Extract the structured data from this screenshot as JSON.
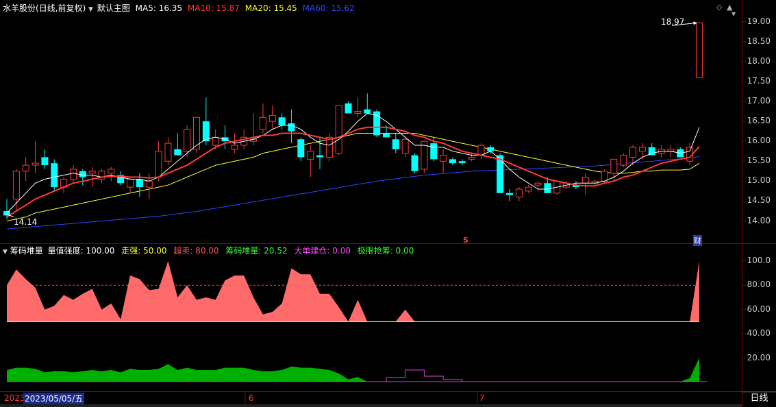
{
  "main_header": {
    "stock": "水羊股份",
    "period": "(日线,前复权)",
    "indicator_name": "默认主图",
    "ma": [
      {
        "label": "MA5: 16.35",
        "color": "#ffffff"
      },
      {
        "label": "MA10: 15.87",
        "color": "#ff3b3b"
      },
      {
        "label": "MA20: 15.45",
        "color": "#ffff33"
      },
      {
        "label": "MA60: 15.62",
        "color": "#3344ff"
      }
    ],
    "icons": [
      "diamond-icon",
      "up-arrow-icon",
      "down-arrow-icon"
    ]
  },
  "sub_header": {
    "name": "筹码堆量",
    "strength": "量值强度: 100.00",
    "items": [
      {
        "label": "走强: 50.00",
        "color": "#ffff33"
      },
      {
        "label": "超卖: 80.00",
        "color": "#ff5555"
      },
      {
        "label": "筹码堆量: 20.52",
        "color": "#33ff33"
      },
      {
        "label": "大单建仓: 0.00",
        "color": "#ff44ff"
      },
      {
        "label": "极限抢筹: 0.00",
        "color": "#33ff33"
      }
    ]
  },
  "main_axis_labels": [
    "19.00",
    "18.50",
    "18.00",
    "17.50",
    "17.00",
    "16.50",
    "16.00",
    "15.50",
    "15.00",
    "14.50",
    "14.00"
  ],
  "sub_axis_labels": [
    "100.0",
    "80.00",
    "60.00",
    "40.00",
    "20.00"
  ],
  "annotations": {
    "high_price": "18.97",
    "low_price": "14.14",
    "event_s": "S",
    "event_cai": "财"
  },
  "bottom_bar": {
    "year_prefix": "2023",
    "cursor_date": "2023/05/05/五",
    "month_6": "6",
    "month_7": "7",
    "period_button": "日线"
  },
  "colors": {
    "up": "#ff3b3b",
    "down": "#00ffff",
    "ma5": "#ffffff",
    "ma10": "#ff3b3b",
    "ma20": "#ffff33",
    "ma60": "#3344ff",
    "grid": "#8b0000",
    "area": "#ff6b6b",
    "volume": "#00b000"
  },
  "chart_data": {
    "type": "candlestick",
    "ylim": [
      13.7,
      19.2
    ],
    "candles": [
      [
        14.25,
        14.55,
        14.05,
        14.14
      ],
      [
        14.55,
        15.3,
        14.25,
        15.25
      ],
      [
        15.25,
        15.6,
        15.0,
        15.4
      ],
      [
        15.4,
        16.0,
        15.2,
        15.45
      ],
      [
        15.6,
        15.8,
        15.3,
        15.4
      ],
      [
        15.45,
        15.55,
        14.75,
        14.85
      ],
      [
        14.85,
        15.1,
        14.7,
        15.05
      ],
      [
        15.05,
        15.4,
        14.95,
        15.3
      ],
      [
        15.25,
        15.3,
        14.9,
        15.1
      ],
      [
        15.2,
        15.35,
        14.85,
        15.25
      ],
      [
        15.05,
        15.3,
        14.95,
        15.25
      ],
      [
        15.2,
        15.35,
        15.0,
        15.3
      ],
      [
        15.15,
        15.25,
        14.9,
        14.95
      ],
      [
        14.85,
        15.1,
        14.7,
        15.05
      ],
      [
        15.05,
        15.2,
        14.6,
        14.85
      ],
      [
        14.85,
        15.2,
        14.55,
        15.0
      ],
      [
        15.1,
        16.0,
        15.0,
        15.75
      ],
      [
        15.5,
        16.1,
        15.4,
        15.95
      ],
      [
        15.8,
        16.2,
        15.7,
        15.65
      ],
      [
        15.75,
        16.4,
        15.6,
        16.3
      ],
      [
        15.8,
        16.6,
        15.7,
        16.6
      ],
      [
        16.5,
        17.1,
        15.9,
        16.0
      ],
      [
        15.9,
        16.3,
        15.8,
        16.1
      ],
      [
        16.1,
        16.4,
        15.8,
        16.0
      ],
      [
        15.8,
        16.2,
        15.7,
        15.9
      ],
      [
        15.9,
        16.3,
        15.8,
        16.1
      ],
      [
        16.0,
        16.7,
        15.9,
        16.05
      ],
      [
        16.3,
        16.95,
        16.2,
        16.6
      ],
      [
        16.5,
        16.9,
        16.3,
        16.65
      ],
      [
        16.6,
        16.7,
        16.3,
        16.4
      ],
      [
        16.45,
        16.8,
        15.95,
        16.25
      ],
      [
        16.05,
        16.1,
        15.5,
        15.6
      ],
      [
        15.55,
        15.9,
        15.1,
        15.75
      ],
      [
        15.65,
        16.1,
        15.3,
        15.6
      ],
      [
        15.6,
        16.2,
        15.5,
        16.1
      ],
      [
        15.7,
        16.75,
        15.65,
        16.9
      ],
      [
        16.95,
        17.0,
        16.8,
        16.7
      ],
      [
        16.7,
        17.1,
        16.6,
        16.75
      ],
      [
        16.8,
        17.2,
        16.7,
        16.7
      ],
      [
        16.75,
        16.8,
        16.1,
        16.15
      ],
      [
        16.2,
        16.4,
        16.1,
        16.1
      ],
      [
        16.05,
        16.2,
        15.7,
        15.8
      ],
      [
        15.7,
        16.1,
        15.6,
        16.05
      ],
      [
        15.65,
        15.7,
        15.2,
        15.25
      ],
      [
        15.3,
        16.0,
        15.2,
        16.0
      ],
      [
        15.95,
        16.1,
        15.5,
        15.55
      ],
      [
        15.5,
        15.8,
        15.2,
        15.65
      ],
      [
        15.55,
        15.6,
        15.4,
        15.45
      ],
      [
        15.5,
        15.55,
        15.4,
        15.45
      ],
      [
        15.55,
        15.7,
        15.5,
        15.6
      ],
      [
        15.65,
        15.95,
        15.55,
        15.9
      ],
      [
        15.85,
        15.9,
        15.7,
        15.75
      ],
      [
        15.65,
        15.7,
        14.7,
        14.7
      ],
      [
        14.7,
        14.8,
        14.5,
        14.65
      ],
      [
        14.6,
        14.85,
        14.5,
        14.8
      ],
      [
        14.75,
        14.9,
        14.7,
        14.85
      ],
      [
        14.9,
        15.0,
        14.75,
        14.95
      ],
      [
        14.95,
        15.1,
        14.7,
        14.7
      ],
      [
        14.7,
        15.0,
        14.65,
        15.0
      ],
      [
        14.85,
        15.0,
        14.8,
        14.95
      ],
      [
        14.9,
        15.0,
        14.8,
        14.85
      ],
      [
        14.95,
        15.2,
        14.65,
        15.1
      ],
      [
        14.95,
        15.05,
        14.9,
        15.0
      ],
      [
        15.0,
        15.3,
        14.95,
        15.25
      ],
      [
        15.2,
        15.55,
        15.0,
        15.55
      ],
      [
        15.4,
        15.7,
        15.35,
        15.65
      ],
      [
        15.6,
        15.9,
        15.4,
        15.85
      ],
      [
        15.75,
        15.95,
        15.55,
        15.85
      ],
      [
        15.85,
        15.95,
        15.75,
        15.65
      ],
      [
        15.7,
        15.9,
        15.6,
        15.8
      ],
      [
        15.75,
        15.9,
        15.6,
        15.8
      ],
      [
        15.8,
        15.85,
        15.6,
        15.6
      ],
      [
        15.5,
        15.95,
        15.4,
        15.85
      ],
      [
        17.6,
        18.97,
        17.6,
        18.97
      ]
    ],
    "ma_series": [
      {
        "name": "MA5",
        "color": "#ffffff",
        "values": [
          14.2,
          14.45,
          14.7,
          14.95,
          15.05,
          15.1,
          15.15,
          15.2,
          15.15,
          15.15,
          15.1,
          15.15,
          15.1,
          15.05,
          15.05,
          15.0,
          15.1,
          15.3,
          15.5,
          15.7,
          15.9,
          16.05,
          16.1,
          16.05,
          15.95,
          16.0,
          16.05,
          16.15,
          16.3,
          16.4,
          16.4,
          16.3,
          16.1,
          15.95,
          15.9,
          16.05,
          16.25,
          16.5,
          16.7,
          16.65,
          16.5,
          16.3,
          16.1,
          15.9,
          15.9,
          15.85,
          15.85,
          15.75,
          15.7,
          15.65,
          15.65,
          15.75,
          15.55,
          15.3,
          15.1,
          14.95,
          14.8,
          14.8,
          14.85,
          14.9,
          14.95,
          14.95,
          14.95,
          15.0,
          15.1,
          15.25,
          15.45,
          15.6,
          15.7,
          15.75,
          15.75,
          15.7,
          15.75,
          16.35
        ]
      },
      {
        "name": "MA10",
        "color": "#ff3b3b",
        "values": [
          14.1,
          14.25,
          14.4,
          14.55,
          14.65,
          14.75,
          14.85,
          14.95,
          15.0,
          15.05,
          15.1,
          15.12,
          15.12,
          15.1,
          15.1,
          15.08,
          15.1,
          15.2,
          15.3,
          15.4,
          15.55,
          15.7,
          15.85,
          15.95,
          16.0,
          16.05,
          16.1,
          16.15,
          16.15,
          16.2,
          16.2,
          16.2,
          16.15,
          16.1,
          16.05,
          16.1,
          16.2,
          16.3,
          16.35,
          16.35,
          16.35,
          16.3,
          16.25,
          16.15,
          16.1,
          16.0,
          15.95,
          15.85,
          15.75,
          15.7,
          15.65,
          15.6,
          15.55,
          15.45,
          15.35,
          15.25,
          15.15,
          15.05,
          15.0,
          14.95,
          14.9,
          14.88,
          14.88,
          14.95,
          15.0,
          15.1,
          15.15,
          15.25,
          15.35,
          15.45,
          15.5,
          15.55,
          15.6,
          15.87
        ]
      },
      {
        "name": "MA20",
        "color": "#ffff33",
        "values": [
          14.0,
          14.05,
          14.1,
          14.2,
          14.25,
          14.3,
          14.35,
          14.4,
          14.45,
          14.5,
          14.55,
          14.6,
          14.65,
          14.7,
          14.75,
          14.8,
          14.85,
          14.9,
          15.0,
          15.1,
          15.2,
          15.3,
          15.4,
          15.45,
          15.5,
          15.55,
          15.6,
          15.7,
          15.75,
          15.8,
          15.85,
          15.9,
          15.95,
          16.0,
          16.05,
          16.1,
          16.15,
          16.2,
          16.2,
          16.2,
          16.2,
          16.2,
          16.2,
          16.2,
          16.15,
          16.1,
          16.05,
          16.0,
          15.95,
          15.9,
          15.85,
          15.8,
          15.75,
          15.7,
          15.65,
          15.6,
          15.55,
          15.5,
          15.45,
          15.4,
          15.35,
          15.3,
          15.25,
          15.22,
          15.2,
          15.2,
          15.22,
          15.25,
          15.25,
          15.28,
          15.28,
          15.28,
          15.3,
          15.45
        ]
      },
      {
        "name": "MA60",
        "color": "#3344ff",
        "values": [
          13.8,
          13.82,
          13.84,
          13.86,
          13.88,
          13.9,
          13.92,
          13.94,
          13.96,
          13.98,
          14.0,
          14.02,
          14.04,
          14.06,
          14.08,
          14.1,
          14.12,
          14.15,
          14.18,
          14.21,
          14.24,
          14.28,
          14.32,
          14.36,
          14.4,
          14.44,
          14.48,
          14.52,
          14.56,
          14.6,
          14.64,
          14.68,
          14.72,
          14.76,
          14.8,
          14.84,
          14.88,
          14.92,
          14.96,
          15.0,
          15.03,
          15.06,
          15.09,
          15.12,
          15.15,
          15.17,
          15.19,
          15.21,
          15.23,
          15.25,
          15.26,
          15.27,
          15.28,
          15.29,
          15.3,
          15.31,
          15.32,
          15.33,
          15.34,
          15.35,
          15.36,
          15.37,
          15.38,
          15.4,
          15.42,
          15.44,
          15.46,
          15.48,
          15.5,
          15.52,
          15.54,
          15.56,
          15.58,
          15.62
        ]
      }
    ],
    "sub_area_values": [
      80,
      93,
      85,
      78,
      60,
      63,
      72,
      68,
      73,
      77,
      60,
      65,
      52,
      88,
      85,
      76,
      77,
      100,
      70,
      80,
      68,
      70,
      68,
      84,
      88,
      88,
      70,
      56,
      58,
      65,
      94,
      89,
      89,
      73,
      73,
      62,
      50,
      68,
      50,
      50,
      50,
      50,
      60,
      50,
      50,
      50,
      50,
      50,
      50,
      50,
      50,
      50,
      50,
      50,
      50,
      50,
      50,
      50,
      50,
      50,
      50,
      50,
      50,
      50,
      50,
      50,
      50,
      50,
      50,
      50,
      50,
      50,
      50,
      100
    ],
    "sub_volume_values": [
      10,
      12,
      12,
      11,
      8,
      9,
      9,
      8,
      9,
      10,
      9,
      10,
      8,
      11,
      10,
      10,
      11,
      15,
      10,
      12,
      10,
      10,
      10,
      12,
      12,
      12,
      10,
      9,
      9,
      10,
      13,
      12,
      12,
      11,
      10,
      7,
      2,
      4,
      0,
      0,
      0,
      0,
      0,
      0,
      0,
      0,
      0,
      0,
      0,
      0,
      0,
      0,
      0,
      0,
      0,
      0,
      0,
      0,
      0,
      0,
      0,
      0,
      0,
      0,
      0,
      0,
      0,
      0,
      0,
      0,
      0,
      0,
      3,
      20.52
    ],
    "sub_levels": {
      "strong": 50,
      "oversold": 80
    },
    "sub_ylim": [
      0,
      105
    ]
  }
}
